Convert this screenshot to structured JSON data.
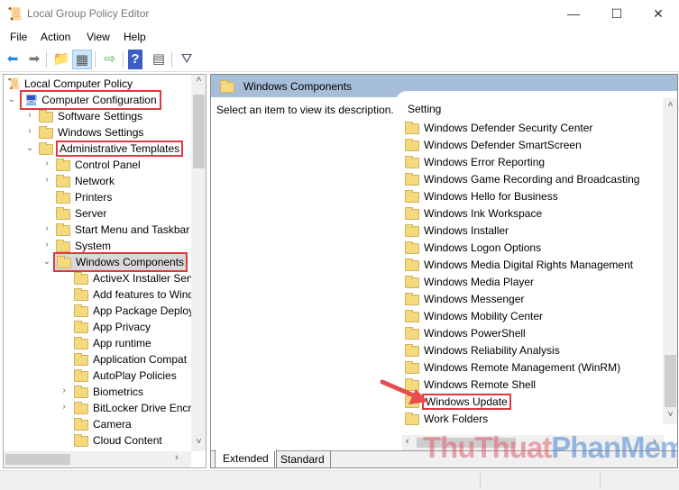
{
  "window": {
    "title": "Local Group Policy Editor",
    "minimize": "—",
    "maximize": "☐",
    "close": "✕"
  },
  "menu": [
    "File",
    "Action",
    "View",
    "Help"
  ],
  "toolbar": {
    "icons": [
      "back-arrow-icon",
      "forward-arrow-icon",
      "up-folder-icon",
      "show-hide-tree-icon",
      "export-list-icon",
      "help-icon",
      "action-pane-icon",
      "filter-icon"
    ]
  },
  "tree": {
    "root": "Local Computer Policy",
    "computer_config": "Computer Configuration",
    "software_settings": "Software Settings",
    "windows_settings": "Windows Settings",
    "admin_templates": "Administrative Templates",
    "children": [
      "Control Panel",
      "Network",
      "Printers",
      "Server",
      "Start Menu and Taskbar",
      "System"
    ],
    "windows_components": "Windows Components",
    "components": [
      "ActiveX Installer Serv",
      "Add features to Wind",
      "App Package Deploy",
      "App Privacy",
      "App runtime",
      "Application Compat",
      "AutoPlay Policies",
      "Biometrics",
      "BitLocker Drive Encry",
      "Camera",
      "Cloud Content"
    ]
  },
  "right": {
    "header": "Windows Components",
    "description": "Select an item to view its description.",
    "column_header": "Setting",
    "items": [
      "Windows Defender Security Center",
      "Windows Defender SmartScreen",
      "Windows Error Reporting",
      "Windows Game Recording and Broadcasting",
      "Windows Hello for Business",
      "Windows Ink Workspace",
      "Windows Installer",
      "Windows Logon Options",
      "Windows Media Digital Rights Management",
      "Windows Media Player",
      "Windows Messenger",
      "Windows Mobility Center",
      "Windows PowerShell",
      "Windows Reliability Analysis",
      "Windows Remote Management (WinRM)",
      "Windows Remote Shell",
      "Windows Update",
      "Work Folders"
    ],
    "tabs": [
      "Extended",
      "Standard"
    ]
  },
  "watermark": {
    "part1": "ThuThuat",
    "part2": "PhanMem.vn"
  },
  "colors": {
    "highlight": "#e0383e",
    "header_bar": "#a7bed8",
    "arrow": "#e84c4c"
  }
}
